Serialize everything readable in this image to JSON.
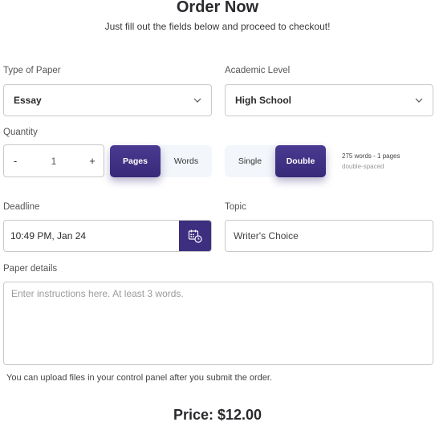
{
  "header": {
    "title": "Order Now",
    "subtitle": "Just fill out the fields below and proceed to checkout!"
  },
  "type_of_paper": {
    "label": "Type of Paper",
    "value": "Essay"
  },
  "academic_level": {
    "label": "Academic Level",
    "value": "High School"
  },
  "quantity": {
    "label": "Quantity",
    "minus": "-",
    "value": "1",
    "plus": "+",
    "units": [
      {
        "label": "Pages",
        "active": true
      },
      {
        "label": "Words",
        "active": false
      }
    ]
  },
  "spacing": {
    "options": [
      {
        "label": "Single",
        "active": false
      },
      {
        "label": "Double",
        "active": true
      }
    ],
    "hint_line1": "275 words - 1 pages",
    "hint_line2": "double-spaced"
  },
  "deadline": {
    "label": "Deadline",
    "value": "10:49 PM, Jan 24",
    "icon": "calendar-clock-icon"
  },
  "topic": {
    "label": "Topic",
    "value": "Writer's Choice"
  },
  "paper_details": {
    "label": "Paper details",
    "placeholder": "Enter instructions here. At least 3 words."
  },
  "upload_note": "You can upload files in your control panel after you submit the order.",
  "price": "Price: $12.00",
  "colors": {
    "accent": "#3d2e80",
    "toggle_bg": "#f3f6fa",
    "border": "#c9c9c9"
  }
}
